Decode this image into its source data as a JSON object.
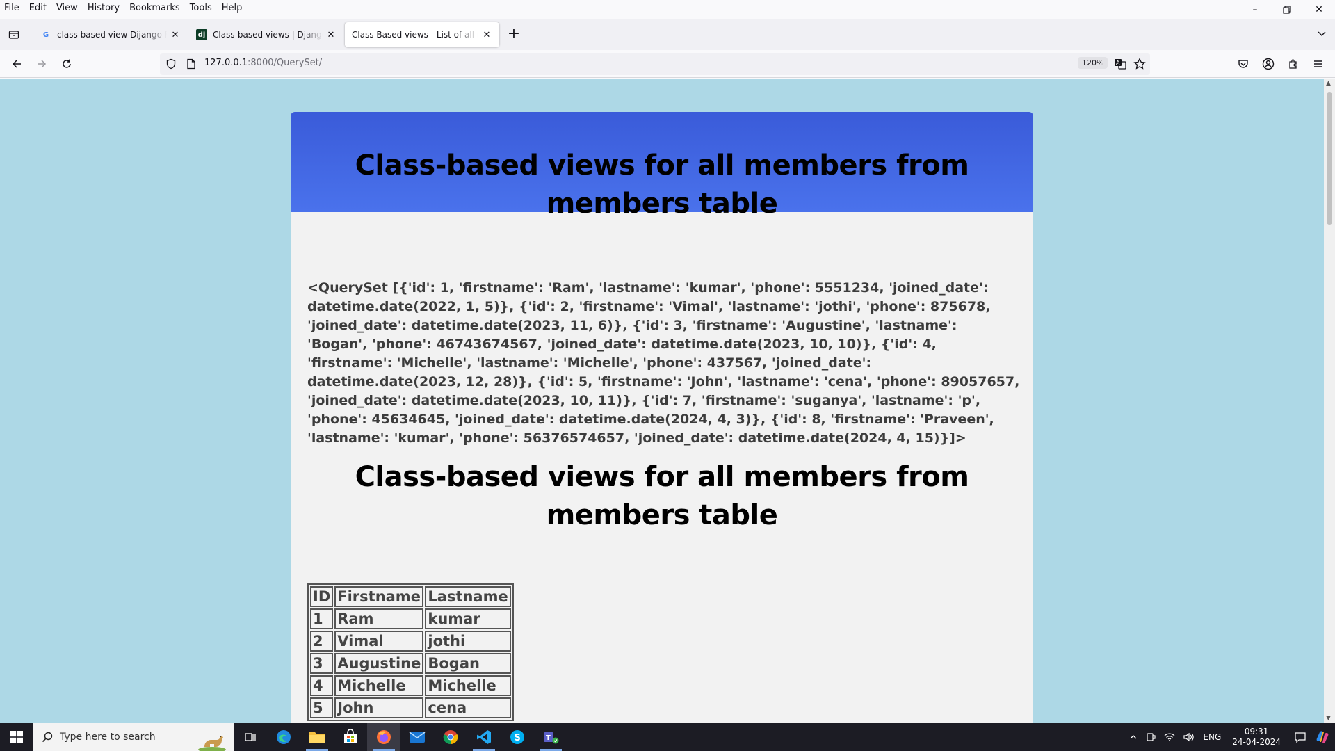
{
  "menu": [
    "File",
    "Edit",
    "View",
    "History",
    "Bookmarks",
    "Tools",
    "Help"
  ],
  "tabs": [
    {
      "title": "class based view Dijango Framework",
      "favicon": "google-g"
    },
    {
      "title": "Class-based views | Django documentation",
      "favicon": "django-dj"
    },
    {
      "title": "Class Based views - List of all members",
      "favicon": "none",
      "active": true
    }
  ],
  "address": {
    "host": "127.0.0.1",
    "rest": ":8000/QuerySet/",
    "zoom": "120%"
  },
  "page": {
    "heading": "Class-based views for all members from members table",
    "queryset": "<QuerySet [{'id': 1, 'firstname': 'Ram', 'lastname': 'kumar', 'phone': 5551234, 'joined_date': datetime.date(2022, 1, 5)}, {'id': 2, 'firstname': 'Vimal', 'lastname': 'jothi', 'phone': 875678, 'joined_date': datetime.date(2023, 11, 6)}, {'id': 3, 'firstname': 'Augustine', 'lastname': 'Bogan', 'phone': 46743674567, 'joined_date': datetime.date(2023, 10, 10)}, {'id': 4, 'firstname': 'Michelle', 'lastname': 'Michelle', 'phone': 437567, 'joined_date': datetime.date(2023, 12, 28)}, {'id': 5, 'firstname': 'John', 'lastname': 'cena', 'phone': 89057657, 'joined_date': datetime.date(2023, 10, 11)}, {'id': 7, 'firstname': 'suganya', 'lastname': 'p', 'phone': 45634645, 'joined_date': datetime.date(2024, 4, 3)}, {'id': 8, 'firstname': 'Praveen', 'lastname': 'kumar', 'phone': 56376574657, 'joined_date': datetime.date(2024, 4, 15)}]>",
    "heading2": "Class-based views for all members from members table",
    "table": {
      "headers": [
        "ID",
        "Firstname",
        "Lastname"
      ],
      "rows": [
        [
          "1",
          "Ram",
          "kumar"
        ],
        [
          "2",
          "Vimal",
          "jothi"
        ],
        [
          "3",
          "Augustine",
          "Bogan"
        ],
        [
          "4",
          "Michelle",
          "Michelle"
        ],
        [
          "5",
          "John",
          "cena"
        ]
      ]
    }
  },
  "taskbar": {
    "search_placeholder": "Type here to search",
    "lang": "ENG",
    "time": "09:31",
    "date": "24-04-2024"
  },
  "colors": {
    "page_bg": "#add8e6",
    "header_gradient_top": "#3a5bd9",
    "header_gradient_bottom": "#4a72ec",
    "card_bg": "#f2f2f2"
  }
}
